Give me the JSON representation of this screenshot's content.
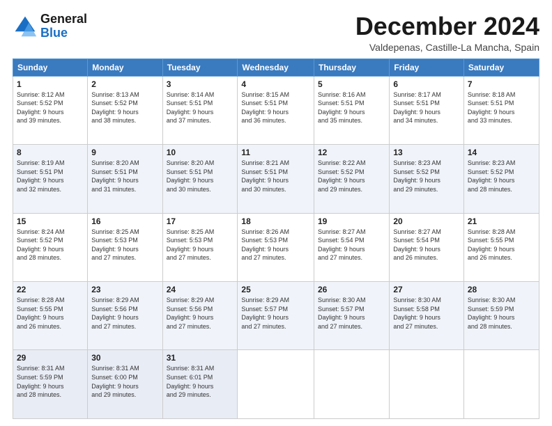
{
  "header": {
    "logo_general": "General",
    "logo_blue": "Blue",
    "month_title": "December 2024",
    "location": "Valdepenas, Castille-La Mancha, Spain"
  },
  "days_of_week": [
    "Sunday",
    "Monday",
    "Tuesday",
    "Wednesday",
    "Thursday",
    "Friday",
    "Saturday"
  ],
  "weeks": [
    [
      {
        "day": 1,
        "sunrise": "8:12 AM",
        "sunset": "5:52 PM",
        "daylight": "9 hours and 39 minutes."
      },
      {
        "day": 2,
        "sunrise": "8:13 AM",
        "sunset": "5:52 PM",
        "daylight": "9 hours and 38 minutes."
      },
      {
        "day": 3,
        "sunrise": "8:14 AM",
        "sunset": "5:51 PM",
        "daylight": "9 hours and 37 minutes."
      },
      {
        "day": 4,
        "sunrise": "8:15 AM",
        "sunset": "5:51 PM",
        "daylight": "9 hours and 36 minutes."
      },
      {
        "day": 5,
        "sunrise": "8:16 AM",
        "sunset": "5:51 PM",
        "daylight": "9 hours and 35 minutes."
      },
      {
        "day": 6,
        "sunrise": "8:17 AM",
        "sunset": "5:51 PM",
        "daylight": "9 hours and 34 minutes."
      },
      {
        "day": 7,
        "sunrise": "8:18 AM",
        "sunset": "5:51 PM",
        "daylight": "9 hours and 33 minutes."
      }
    ],
    [
      {
        "day": 8,
        "sunrise": "8:19 AM",
        "sunset": "5:51 PM",
        "daylight": "9 hours and 32 minutes."
      },
      {
        "day": 9,
        "sunrise": "8:20 AM",
        "sunset": "5:51 PM",
        "daylight": "9 hours and 31 minutes."
      },
      {
        "day": 10,
        "sunrise": "8:20 AM",
        "sunset": "5:51 PM",
        "daylight": "9 hours and 30 minutes."
      },
      {
        "day": 11,
        "sunrise": "8:21 AM",
        "sunset": "5:51 PM",
        "daylight": "9 hours and 30 minutes."
      },
      {
        "day": 12,
        "sunrise": "8:22 AM",
        "sunset": "5:52 PM",
        "daylight": "9 hours and 29 minutes."
      },
      {
        "day": 13,
        "sunrise": "8:23 AM",
        "sunset": "5:52 PM",
        "daylight": "9 hours and 29 minutes."
      },
      {
        "day": 14,
        "sunrise": "8:23 AM",
        "sunset": "5:52 PM",
        "daylight": "9 hours and 28 minutes."
      }
    ],
    [
      {
        "day": 15,
        "sunrise": "8:24 AM",
        "sunset": "5:52 PM",
        "daylight": "9 hours and 28 minutes."
      },
      {
        "day": 16,
        "sunrise": "8:25 AM",
        "sunset": "5:53 PM",
        "daylight": "9 hours and 27 minutes."
      },
      {
        "day": 17,
        "sunrise": "8:25 AM",
        "sunset": "5:53 PM",
        "daylight": "9 hours and 27 minutes."
      },
      {
        "day": 18,
        "sunrise": "8:26 AM",
        "sunset": "5:53 PM",
        "daylight": "9 hours and 27 minutes."
      },
      {
        "day": 19,
        "sunrise": "8:27 AM",
        "sunset": "5:54 PM",
        "daylight": "9 hours and 27 minutes."
      },
      {
        "day": 20,
        "sunrise": "8:27 AM",
        "sunset": "5:54 PM",
        "daylight": "9 hours and 26 minutes."
      },
      {
        "day": 21,
        "sunrise": "8:28 AM",
        "sunset": "5:55 PM",
        "daylight": "9 hours and 26 minutes."
      }
    ],
    [
      {
        "day": 22,
        "sunrise": "8:28 AM",
        "sunset": "5:55 PM",
        "daylight": "9 hours and 26 minutes."
      },
      {
        "day": 23,
        "sunrise": "8:29 AM",
        "sunset": "5:56 PM",
        "daylight": "9 hours and 27 minutes."
      },
      {
        "day": 24,
        "sunrise": "8:29 AM",
        "sunset": "5:56 PM",
        "daylight": "9 hours and 27 minutes."
      },
      {
        "day": 25,
        "sunrise": "8:29 AM",
        "sunset": "5:57 PM",
        "daylight": "9 hours and 27 minutes."
      },
      {
        "day": 26,
        "sunrise": "8:30 AM",
        "sunset": "5:57 PM",
        "daylight": "9 hours and 27 minutes."
      },
      {
        "day": 27,
        "sunrise": "8:30 AM",
        "sunset": "5:58 PM",
        "daylight": "9 hours and 27 minutes."
      },
      {
        "day": 28,
        "sunrise": "8:30 AM",
        "sunset": "5:59 PM",
        "daylight": "9 hours and 28 minutes."
      }
    ],
    [
      {
        "day": 29,
        "sunrise": "8:31 AM",
        "sunset": "5:59 PM",
        "daylight": "9 hours and 28 minutes."
      },
      {
        "day": 30,
        "sunrise": "8:31 AM",
        "sunset": "6:00 PM",
        "daylight": "9 hours and 29 minutes."
      },
      {
        "day": 31,
        "sunrise": "8:31 AM",
        "sunset": "6:01 PM",
        "daylight": "9 hours and 29 minutes."
      },
      null,
      null,
      null,
      null
    ]
  ]
}
